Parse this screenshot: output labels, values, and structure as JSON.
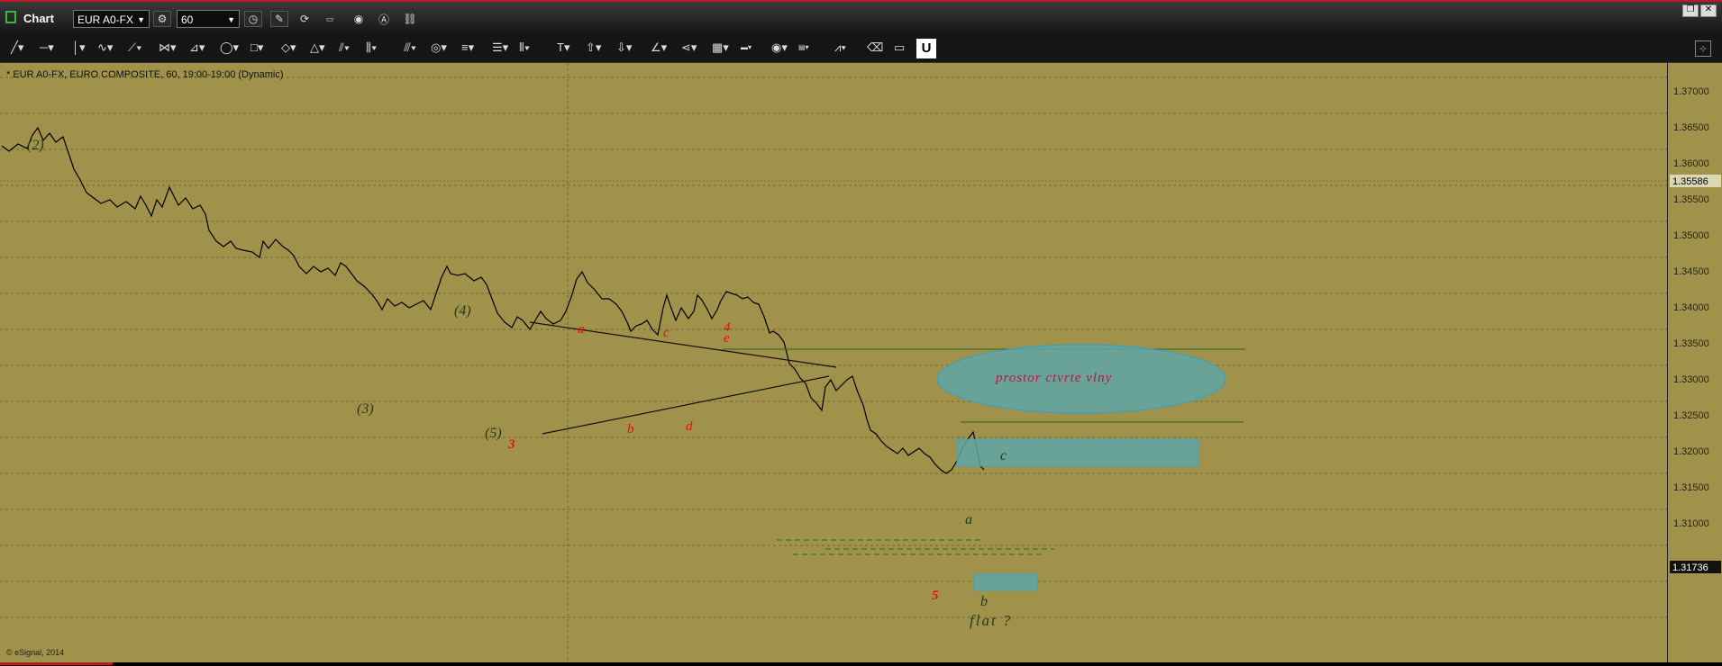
{
  "window": {
    "app_title": "Chart",
    "symbol": "EUR A0-FX",
    "interval": "60"
  },
  "chart": {
    "info": "* EUR A0-FX, EURO COMPOSITE, 60, 19:00-19:00 (Dynamic)",
    "copyright": "© eSignal, 2014",
    "price_labels": [
      "1.37000",
      "1.36500",
      "1.36000",
      "1.35500",
      "1.35000",
      "1.34500",
      "1.34000",
      "1.33500",
      "1.33000",
      "1.32500",
      "1.32000",
      "1.31500",
      "1.31000"
    ],
    "marker_prices": [
      "1.35586",
      "1.31736"
    ],
    "annotations": {
      "w2": "(2)",
      "w4": "(4)",
      "w3": "(3)",
      "w5": "(5)",
      "a_red": "a",
      "c_red": "c",
      "num4": "4",
      "e_red": "e",
      "num3": "3",
      "b_red": "b",
      "d_red": "d",
      "num5": "5",
      "a_green": "a",
      "b_green": "b",
      "c_green": "c",
      "ellipse_text": "prostor ctvrte vlny",
      "flat_text": "flat ?"
    }
  },
  "colors": {
    "background": "#a0924a",
    "wave_red": "#e01010",
    "zone": "#5fa6a6"
  }
}
